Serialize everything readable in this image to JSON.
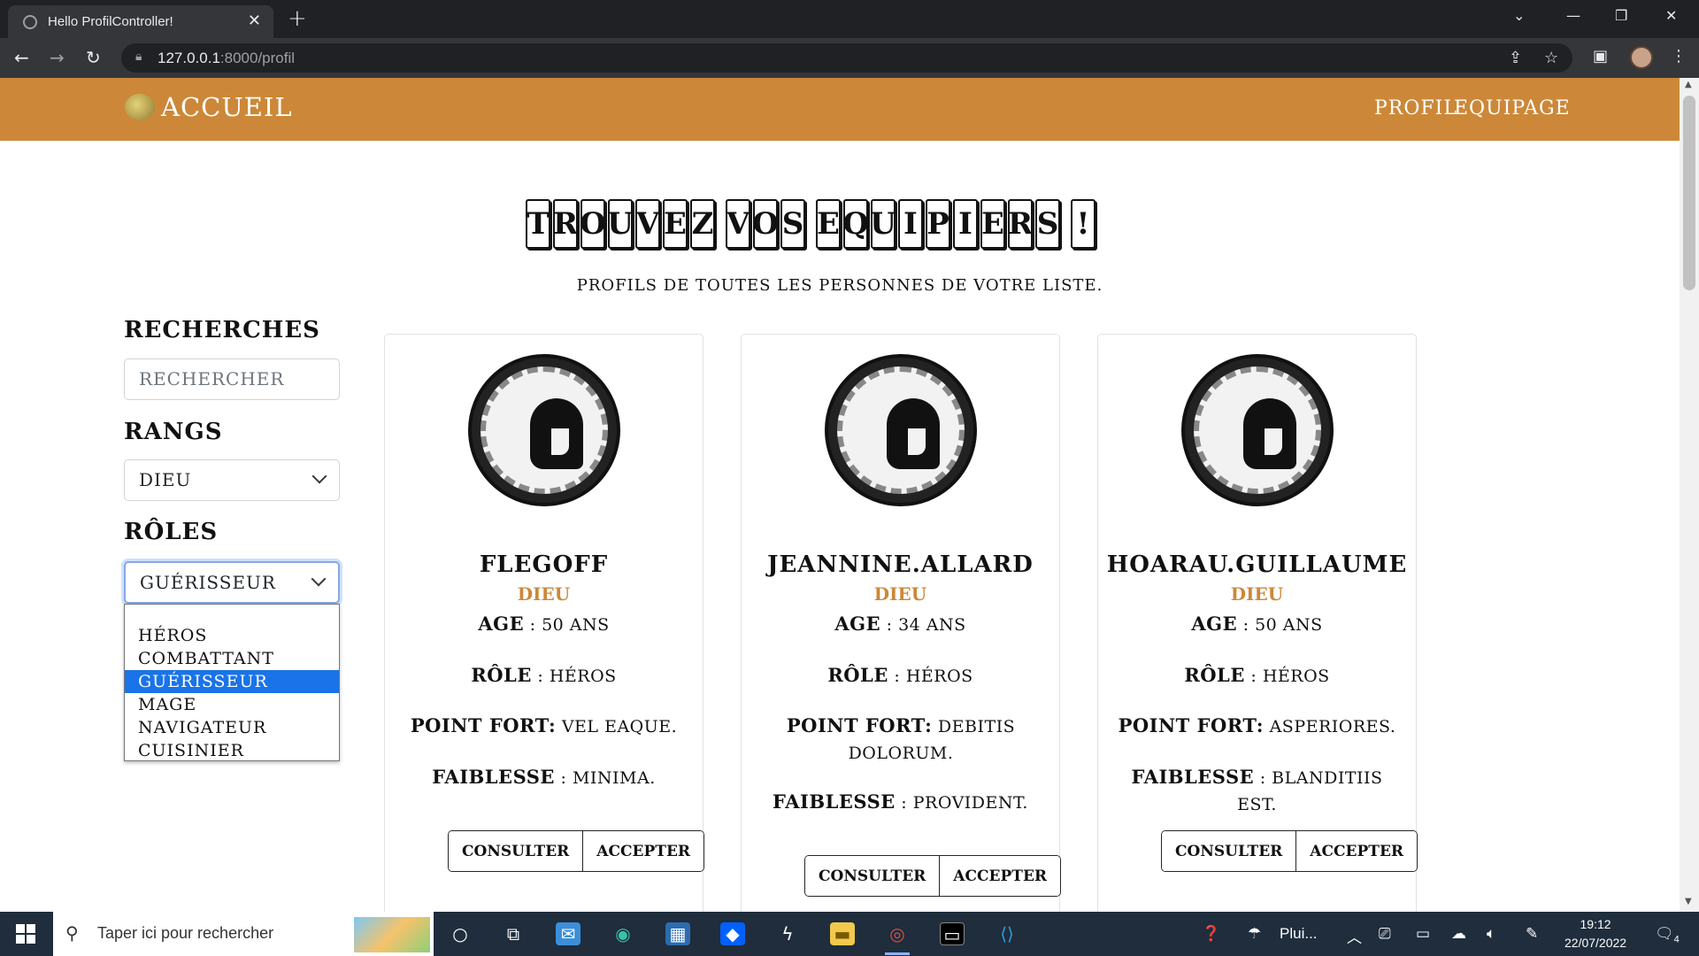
{
  "browser": {
    "tab_title": "Hello ProfilController!",
    "url_host": "127.0.0.1",
    "url_path": ":8000/profil"
  },
  "navbar": {
    "brand": "ACCUEIL",
    "links": [
      "PROFIL",
      "EQUIPAGE"
    ],
    "color": "#cc8838"
  },
  "header": {
    "title_words": [
      "TROUVEZ",
      "VOS",
      "EQUIPIERS",
      "!"
    ],
    "subtitle": "PROFILS DE TOUTES LES PERSONNES DE VOTRE LISTE."
  },
  "sidebar": {
    "search_heading": "RECHERCHES",
    "search_placeholder": "RECHERCHER",
    "ranks_heading": "RANGS",
    "rank_selected": "DIEU",
    "roles_heading": "RÔLES",
    "role_selected": "GUÉRISSEUR",
    "role_options": [
      "",
      "HÉROS",
      "COMBATTANT",
      "GUÉRISSEUR",
      "MAGE",
      "NAVIGATEUR",
      "CUISINIER"
    ]
  },
  "labels": {
    "age": "AGE",
    "role": "RÔLE",
    "strength": "POINT FORT:",
    "weakness": "FAIBLESSE",
    "consult": "CONSULTER",
    "accept": "ACCEPTER"
  },
  "profiles": [
    {
      "name": "FLEGOFF",
      "rank": "DIEU",
      "age": ": 50 ANS",
      "role": ": HÉROS",
      "strength": "VEL EAQUE.",
      "weakness": ": MINIMA."
    },
    {
      "name": "JEANNINE.ALLARD",
      "rank": "DIEU",
      "age": ": 34 ANS",
      "role": ": HÉROS",
      "strength": "DEBITIS DOLORUM.",
      "weakness": ": PROVIDENT."
    },
    {
      "name": "HOARAU.GUILLAUME",
      "rank": "DIEU",
      "age": ": 50 ANS",
      "role": ": HÉROS",
      "strength": "ASPERIORES.",
      "weakness": ": BLANDITIIS EST."
    }
  ],
  "taskbar": {
    "search_placeholder": "Taper ici pour rechercher",
    "weather": "Plui...",
    "time": "19:12",
    "date": "22/07/2022",
    "notif_count": "4"
  }
}
